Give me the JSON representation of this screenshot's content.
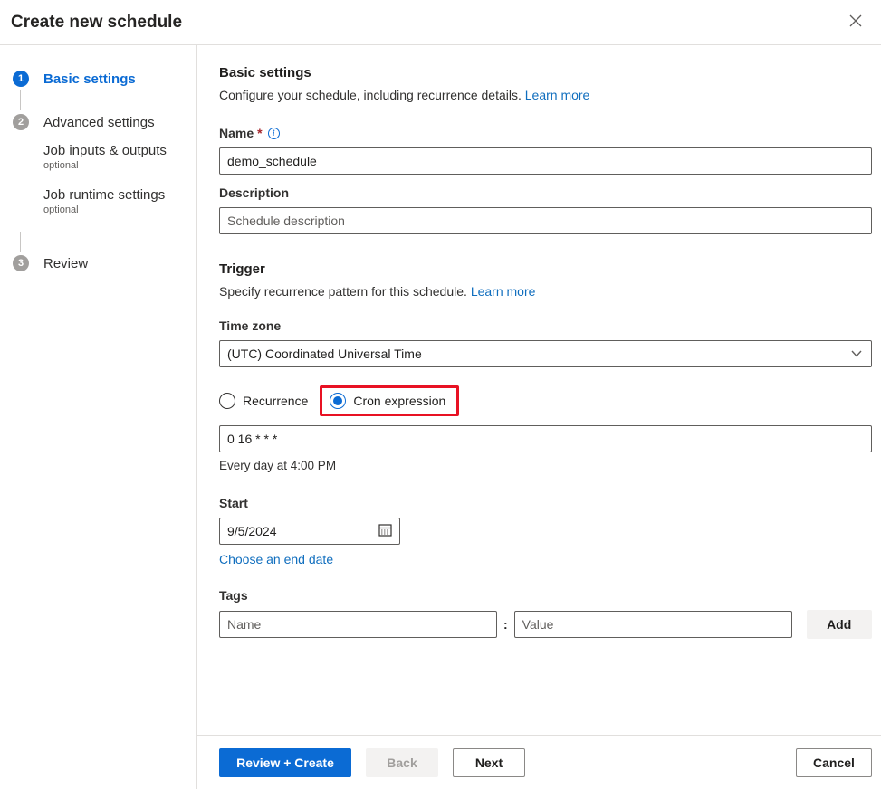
{
  "dialog": {
    "title": "Create new schedule"
  },
  "stepper": {
    "steps": [
      {
        "number": "1",
        "label": "Basic settings",
        "state": "active"
      },
      {
        "number": "2",
        "label": "Advanced settings",
        "state": "upcoming"
      },
      {
        "number": "3",
        "label": "Review",
        "state": "upcoming"
      }
    ],
    "substeps": [
      {
        "label": "Job inputs & outputs",
        "note": "optional"
      },
      {
        "label": "Job runtime settings",
        "note": "optional"
      }
    ]
  },
  "basic_settings": {
    "heading": "Basic settings",
    "subtitle": "Configure your schedule, including recurrence details.",
    "learn_more": "Learn more",
    "name_label": "Name",
    "required_marker": "*",
    "info_glyph": "i",
    "name_value": "demo_schedule",
    "description_label": "Description",
    "description_placeholder": "Schedule description"
  },
  "trigger": {
    "heading": "Trigger",
    "subtitle": "Specify recurrence pattern for this schedule.",
    "learn_more": "Learn more",
    "timezone_label": "Time zone",
    "timezone_value": "(UTC) Coordinated Universal Time",
    "recurrence_option": "Recurrence",
    "cron_option": "Cron expression",
    "cron_value": "0 16 * * *",
    "cron_hint": "Every day at 4:00 PM",
    "start_label": "Start",
    "start_value": "9/5/2024",
    "end_date_link": "Choose an end date"
  },
  "tags": {
    "label": "Tags",
    "name_placeholder": "Name",
    "separator": ":",
    "value_placeholder": "Value",
    "add_button": "Add"
  },
  "footer": {
    "review_create": "Review + Create",
    "back": "Back",
    "next": "Next",
    "cancel": "Cancel"
  },
  "colors": {
    "accent_blue": "#0b6bd4",
    "link_blue": "#106ebe",
    "highlight_red": "#e81123",
    "required_red": "#a4262c",
    "disabled_gray": "#f3f2f1"
  }
}
